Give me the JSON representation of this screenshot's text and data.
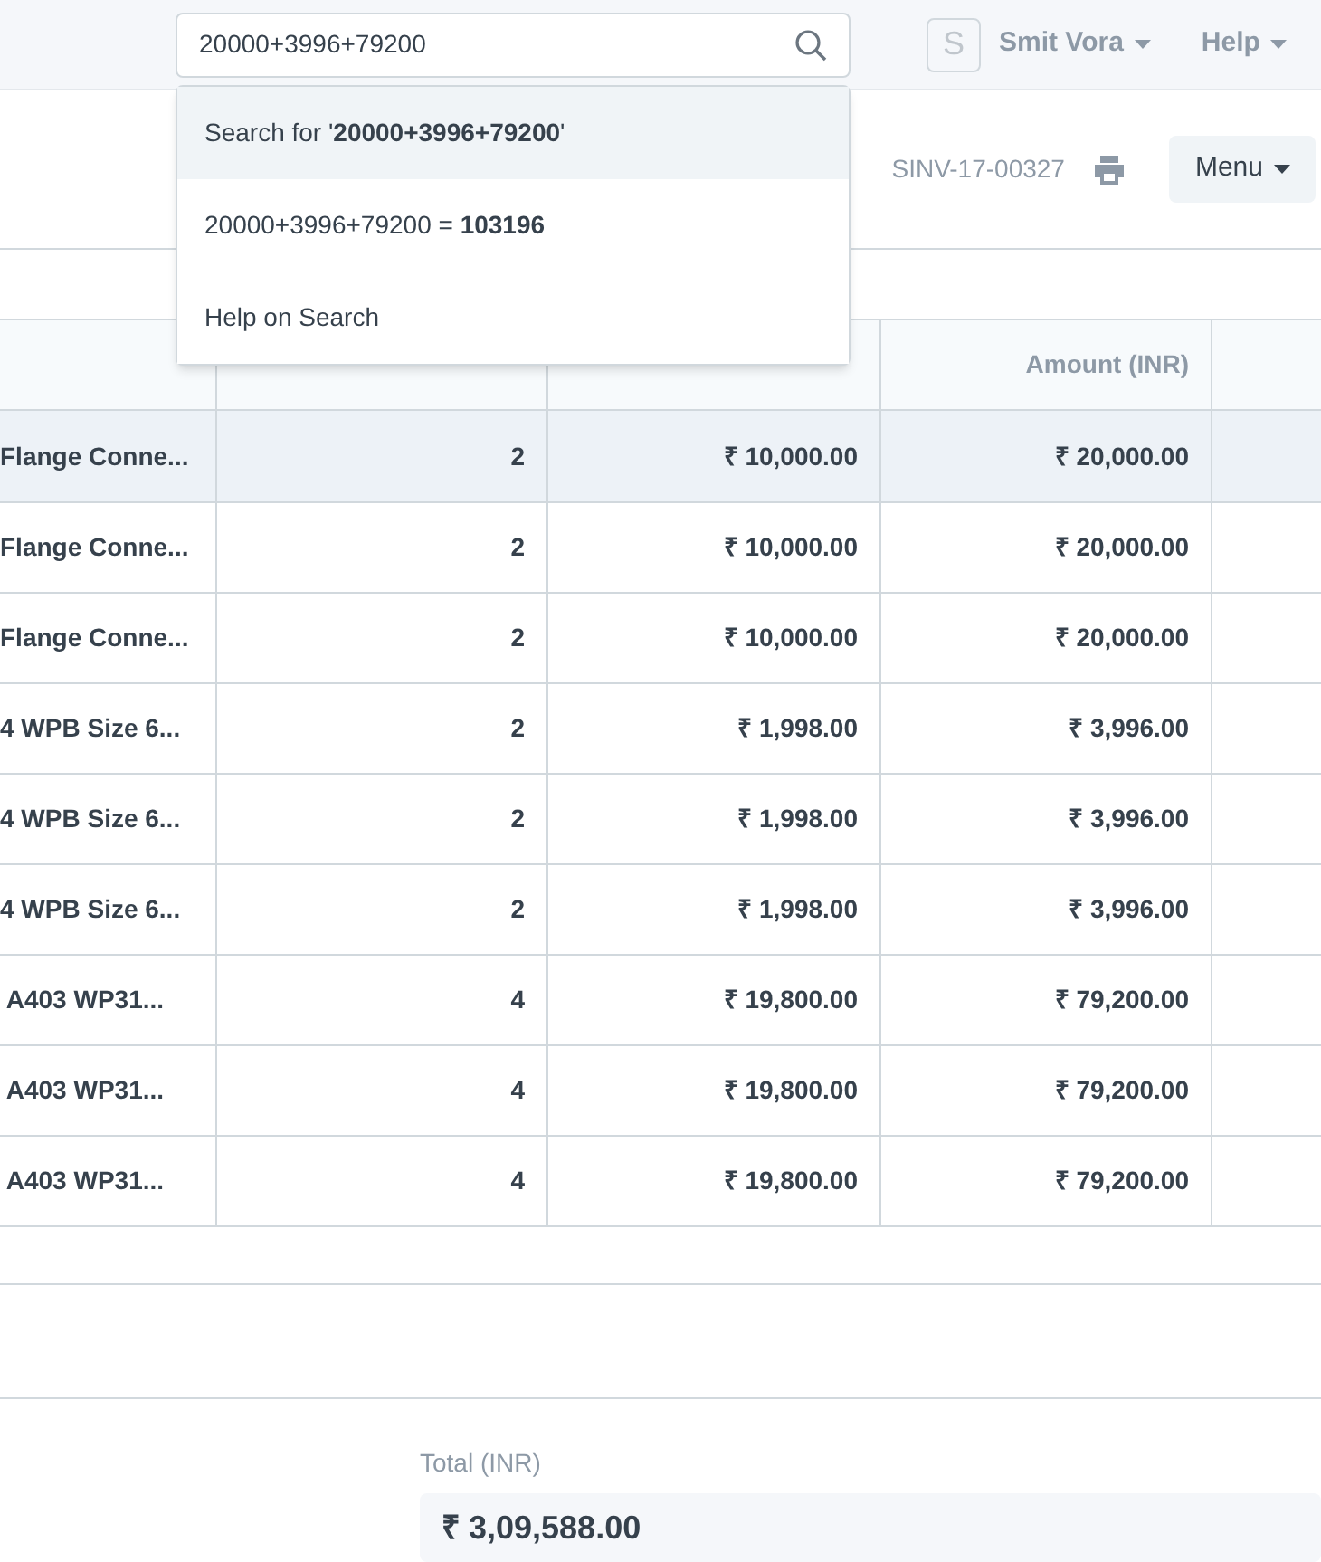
{
  "navbar": {
    "search": {
      "value": "20000+3996+79200"
    },
    "user": {
      "avatar": "S",
      "name": "Smit Vora"
    },
    "help": "Help"
  },
  "search_dropdown": [
    {
      "text": "Search for '**20000+3996+79200**'",
      "selected": true
    },
    {
      "text": "20000+3996+79200 = **103196**",
      "selected": false
    },
    {
      "text": "Help on Search",
      "selected": false
    }
  ],
  "page_header": {
    "doc_name": "SINV-17-00327",
    "menu": "Menu"
  },
  "table": {
    "columns": [
      "Amount (INR)"
    ],
    "rows": [
      {
        "item": "Flange Conne...",
        "qty": "2",
        "rate": "₹ 10,000.00",
        "amount": "₹ 20,000.00",
        "selected": true
      },
      {
        "item": "Flange Conne...",
        "qty": "2",
        "rate": "₹ 10,000.00",
        "amount": "₹ 20,000.00",
        "selected": false
      },
      {
        "item": "Flange Conne...",
        "qty": "2",
        "rate": "₹ 10,000.00",
        "amount": "₹ 20,000.00",
        "selected": false
      },
      {
        "item": "4 WPB Size 6...",
        "qty": "2",
        "rate": "₹ 1,998.00",
        "amount": "₹ 3,996.00",
        "selected": false
      },
      {
        "item": "4 WPB Size 6...",
        "qty": "2",
        "rate": "₹ 1,998.00",
        "amount": "₹ 3,996.00",
        "selected": false
      },
      {
        "item": "4 WPB Size 6...",
        "qty": "2",
        "rate": "₹ 1,998.00",
        "amount": "₹ 3,996.00",
        "selected": false
      },
      {
        "item": " A403 WP31...",
        "qty": "4",
        "rate": "₹ 19,800.00",
        "amount": "₹ 79,200.00",
        "selected": false
      },
      {
        "item": " A403 WP31...",
        "qty": "4",
        "rate": "₹ 19,800.00",
        "amount": "₹ 79,200.00",
        "selected": false
      },
      {
        "item": " A403 WP31...",
        "qty": "4",
        "rate": "₹ 19,800.00",
        "amount": "₹ 79,200.00",
        "selected": false
      }
    ]
  },
  "total": {
    "label": "Total (INR)",
    "value": "₹ 3,09,588.00"
  }
}
